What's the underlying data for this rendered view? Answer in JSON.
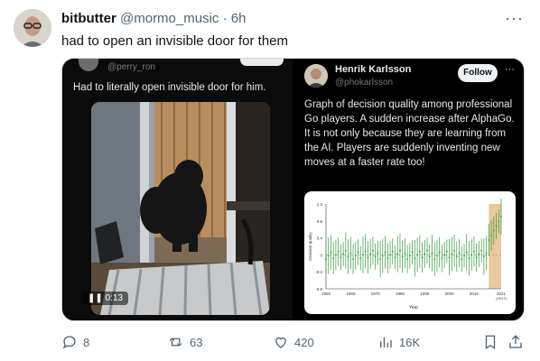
{
  "tweet": {
    "author_name": "bitbutter",
    "author_handle": "@mormo_music",
    "separator": "·",
    "time": "6h",
    "text": "had to open an invisible door for them",
    "more_icon": "more-icon"
  },
  "quoted_left": {
    "handle": "@perry_ron",
    "caption": "Had to literally open invisible door for him.",
    "video_time": "0:13"
  },
  "quoted_right": {
    "name": "Henrik Karlsson",
    "handle": "@phokarlsson",
    "follow_label": "Follow",
    "text": "Graph of decision quality among professional Go players. A sudden increase after AlphaGo. It is not only because they are learning from the AI. Players are suddenly inventing new moves at a faster rate too!"
  },
  "chart_data": {
    "type": "scatter",
    "xlabel": "Year",
    "ylabel": "Decision quality",
    "x_ticks": [
      "1950",
      "1960",
      "1970",
      "1980",
      "1990",
      "2000",
      "2010",
      "2021"
    ],
    "x_tick_extra": "(2017)",
    "y_ticks": [
      "1.2",
      "0.8",
      "0.4",
      "0",
      "-0.4",
      "-0.8"
    ],
    "ylim": [
      -0.8,
      1.2
    ],
    "xlim": [
      1950,
      2021
    ],
    "series_color": "#2f9a3a",
    "highlight_color": "#e8c9a0",
    "highlight_range": [
      2016,
      2021
    ]
  },
  "actions": {
    "replies": "8",
    "reposts": "63",
    "likes": "420",
    "views": "16K"
  },
  "colors": {
    "text": "#0f1419",
    "muted": "#536471"
  }
}
